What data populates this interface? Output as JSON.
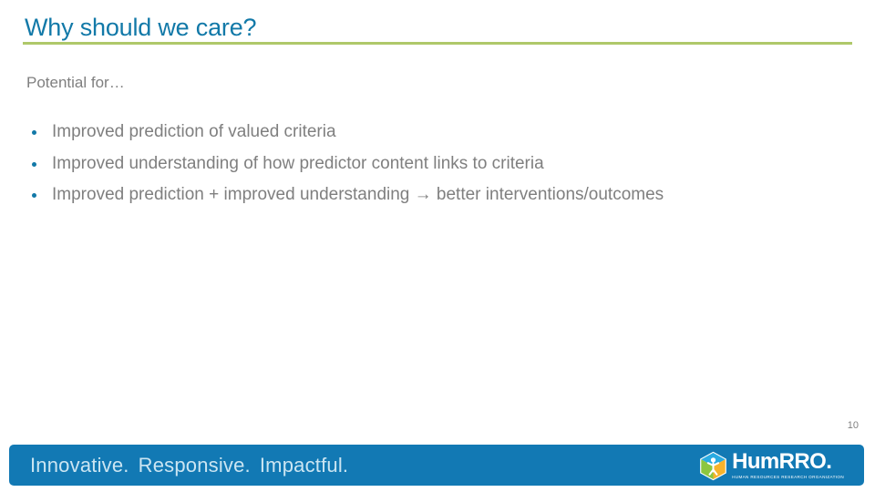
{
  "slide": {
    "title": "Why should we care?",
    "subhead": "Potential for…",
    "bullets": [
      "Improved prediction of valued criteria",
      "Improved understanding of how predictor content links to criteria",
      "Improved prediction + improved understanding → better interventions/outcomes"
    ],
    "page_number": "10"
  },
  "footer": {
    "tagline_1": "Innovative.",
    "tagline_2": "Responsive.",
    "tagline_3": "Impactful.",
    "logo_word": "HumRRO.",
    "logo_sub": "HUMAN RESOURCES RESEARCH ORGANIZATION"
  },
  "colors": {
    "title": "#1279a8",
    "rule": "#afc86a",
    "body_text": "#7f7f7f",
    "bullet_marker": "#1279a8",
    "footer_bg": "#1279b4",
    "footer_text": "#cbe5f2",
    "logo_cube_green": "#8cc63f",
    "logo_cube_yellow": "#f7b32b",
    "logo_cube_blue": "#29abe2"
  }
}
